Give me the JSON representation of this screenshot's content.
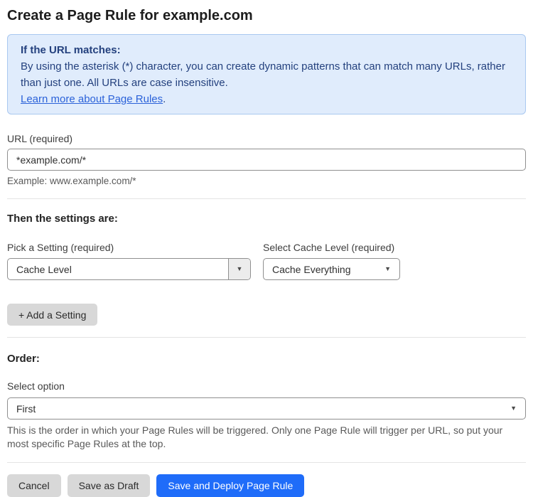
{
  "page": {
    "title": "Create a Page Rule for example.com"
  },
  "info_box": {
    "heading": "If the URL matches:",
    "body": "By using the asterisk (*) character, you can create dynamic patterns that can match many URLs, rather than just one. All URLs are case insensitive.",
    "link_label": "Learn more about Page Rules",
    "link_suffix": "."
  },
  "url_field": {
    "label": "URL (required)",
    "value": "*example.com/*",
    "helper": "Example: www.example.com/*"
  },
  "settings_section": {
    "heading": "Then the settings are:",
    "setting_picker": {
      "label": "Pick a Setting (required)",
      "value": "Cache Level"
    },
    "cache_level_picker": {
      "label": "Select Cache Level (required)",
      "value": "Cache Everything"
    },
    "add_setting_label": "+ Add a Setting"
  },
  "order_section": {
    "heading": "Order:",
    "select_label": "Select option",
    "value": "First",
    "helper": "This is the order in which your Page Rules will be triggered. Only one Page Rule will trigger per URL, so put your most specific Page Rules at the top."
  },
  "actions": {
    "cancel": "Cancel",
    "save_draft": "Save as Draft",
    "save_deploy": "Save and Deploy Page Rule"
  },
  "icons": {
    "dropdown_arrow": "▼"
  },
  "colors": {
    "accent_blue": "#1f6cf9",
    "info_bg": "#e0ecfc",
    "info_border": "#a9c8f0",
    "info_text": "#24417e",
    "link_blue": "#2b62d9"
  }
}
